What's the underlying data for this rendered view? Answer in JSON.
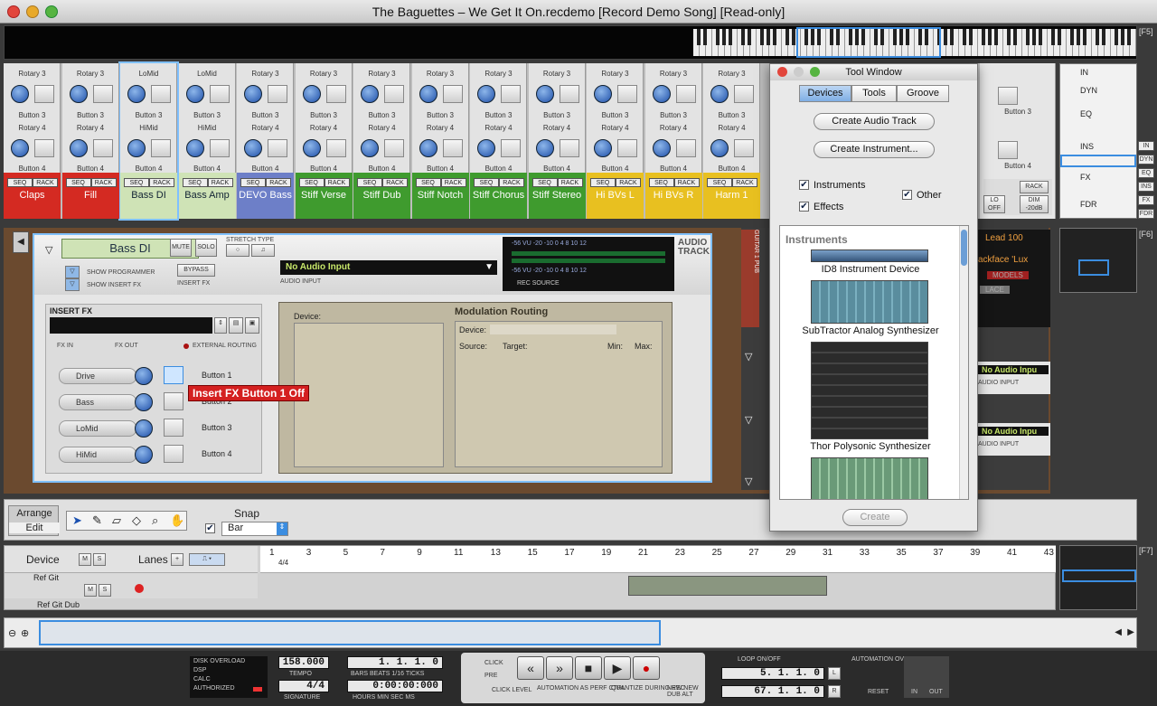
{
  "window": {
    "title": "The Baguettes – We Get It On.recdemo [Record Demo Song] [Read-only]"
  },
  "fkeys": {
    "f5": "[F5]",
    "f6": "[F6]",
    "f7": "[F7]"
  },
  "mixer": {
    "channels": [
      {
        "name": "Claps",
        "color": "#d42a22",
        "top1": "Rotary 3",
        "top2": "Rotary 4"
      },
      {
        "name": "Fill",
        "color": "#d42a22",
        "top1": "Rotary 3",
        "top2": "Rotary 4"
      },
      {
        "name": "Bass DI",
        "color": "#cfe3b6",
        "top1": "LoMid",
        "top2": "HiMid"
      },
      {
        "name": "Bass Amp",
        "color": "#cfe3b6",
        "top1": "LoMid",
        "top2": "HiMid"
      },
      {
        "name": "DEVO Bass",
        "color": "#6d7fc8",
        "top1": "Rotary 3",
        "top2": "Rotary 4"
      },
      {
        "name": "Stiff Verse",
        "color": "#3f9b2e",
        "top1": "Rotary 3",
        "top2": "Rotary 4"
      },
      {
        "name": "Stiff Dub",
        "color": "#3f9b2e",
        "top1": "Rotary 3",
        "top2": "Rotary 4"
      },
      {
        "name": "Stiff Notch",
        "color": "#3f9b2e",
        "top1": "Rotary 3",
        "top2": "Rotary 4"
      },
      {
        "name": "Stiff Chorus",
        "color": "#3f9b2e",
        "top1": "Rotary 3",
        "top2": "Rotary 4"
      },
      {
        "name": "Stiff Stereo",
        "color": "#3f9b2e",
        "top1": "Rotary 3",
        "top2": "Rotary 4"
      },
      {
        "name": "Hi BVs L",
        "color": "#e8c020",
        "top1": "Rotary 3",
        "top2": "Rotary 4"
      },
      {
        "name": "Hi BVs R",
        "color": "#e8c020",
        "top1": "Rotary 3",
        "top2": "Rotary 4"
      },
      {
        "name": "Harm 1",
        "color": "#e8c020",
        "top1": "Rotary 3",
        "top2": "Rotary 4"
      }
    ],
    "button3": "Button 3",
    "button4": "Button 4",
    "seq": "SEQ",
    "rack": "RACK",
    "right_btn3": "Button 3",
    "right_btn4": "Button 4",
    "lo_off": "LO OFF",
    "dim": "DIM -20dB"
  },
  "nav": {
    "in": "IN",
    "dyn": "DYN",
    "eq": "EQ",
    "ins": "INS",
    "fx": "FX",
    "fdr": "FDR"
  },
  "device": {
    "name": "Bass DI",
    "mute": "MUTE",
    "solo": "SOLO",
    "stretch": "STRETCH TYPE",
    "show_programmer": "SHOW PROGRAMMER",
    "show_insert_fx": "SHOW INSERT FX",
    "bypass": "BYPASS",
    "insert_fx_small": "INSERT FX",
    "audio_input_value": "No Audio Input",
    "audio_input_label": "AUDIO INPUT",
    "rec_source": "REC SOURCE",
    "audio_track": "AUDIO TRACK",
    "vu_scale": "-56  VU  -20  -10   0   4   8 10 12",
    "insert_fx_title": "INSERT FX",
    "fx_in": "FX IN",
    "fx_out": "FX OUT",
    "external_routing": "EXTERNAL ROUTING",
    "fx_rows": [
      {
        "label": "Drive",
        "button": "Button 1"
      },
      {
        "label": "Bass",
        "button": "Button 2"
      },
      {
        "label": "LoMid",
        "button": "Button 3"
      },
      {
        "label": "HiMid",
        "button": "Button 4"
      }
    ],
    "tooltip": "Insert FX Button 1 Off",
    "device_label": "Device:",
    "mod_title": "Modulation Routing",
    "mod_device": "Device:",
    "mod_cols": [
      "Source:",
      "Target:",
      "Min:",
      "Max:"
    ]
  },
  "rack_right": {
    "lead": "Lead 100",
    "backface": "ackface 'Lux",
    "models": "MODELS",
    "lace": "LACE",
    "no_input1": "No Audio Inpu",
    "audio_input1": "AUDIO INPUT",
    "no_input2": "No Audio Inpu",
    "audio_input2": "AUDIO INPUT",
    "guitar": "GUITAR 1 PUB"
  },
  "toolbar": {
    "arrange": "Arrange",
    "edit": "Edit",
    "snap": "Snap",
    "snap_value": "Bar"
  },
  "sequencer": {
    "device": "Device",
    "m": "M",
    "s": "S",
    "lanes": "Lanes",
    "tracks": [
      "Ref Git",
      "Ref Git Dub"
    ],
    "ruler": [
      "1",
      "3",
      "5",
      "7",
      "9",
      "11",
      "13",
      "15",
      "17",
      "19",
      "21",
      "23",
      "25",
      "27",
      "29",
      "31",
      "33",
      "35",
      "37",
      "39",
      "41",
      "43"
    ],
    "sig": "4/4"
  },
  "transport": {
    "disk": "DISK OVERLOAD",
    "dsp": "DSP",
    "calc": "CALC",
    "authorized": "AUTHORIZED",
    "tempo": "158.000",
    "tempo_label": "TEMPO",
    "signature": "4/4",
    "signature_label": "SIGNATURE",
    "bars": "1.  1.  1.    0",
    "bars_label": "BARS  BEATS  1/16  TICKS",
    "time": "0:00:00:000",
    "time_label": "HOURS   MIN   SEC    MS",
    "click": "CLICK",
    "pre": "PRE",
    "click_level": "CLICK LEVEL",
    "auto_perf": "AUTOMATION AS PERF CTRL",
    "quantize": "QUANTIZE DURING REC",
    "new_dub": "NEW NEW DUB ALT",
    "loop": "LOOP ON/OFF",
    "left": "5.  1.  1.    0",
    "right": "67.  1.  1.    0",
    "l": "L",
    "r": "R",
    "auto_override": "AUTOMATION OVERRIDE",
    "reset": "RESET",
    "in": "IN",
    "out": "OUT"
  },
  "tool_window": {
    "title": "Tool Window",
    "tabs": [
      "Devices",
      "Tools",
      "Groove"
    ],
    "create_audio": "Create Audio Track",
    "create_instrument": "Create Instrument...",
    "instruments_cb": "Instruments",
    "effects_cb": "Effects",
    "other_cb": "Other",
    "section": "Instruments",
    "items": [
      "ID8 Instrument Device",
      "SubTractor Analog Synthesizer",
      "Thor Polysonic Synthesizer"
    ],
    "create": "Create"
  },
  "colors": {
    "accent": "#3b8de0",
    "tooltip": "#d42020"
  }
}
